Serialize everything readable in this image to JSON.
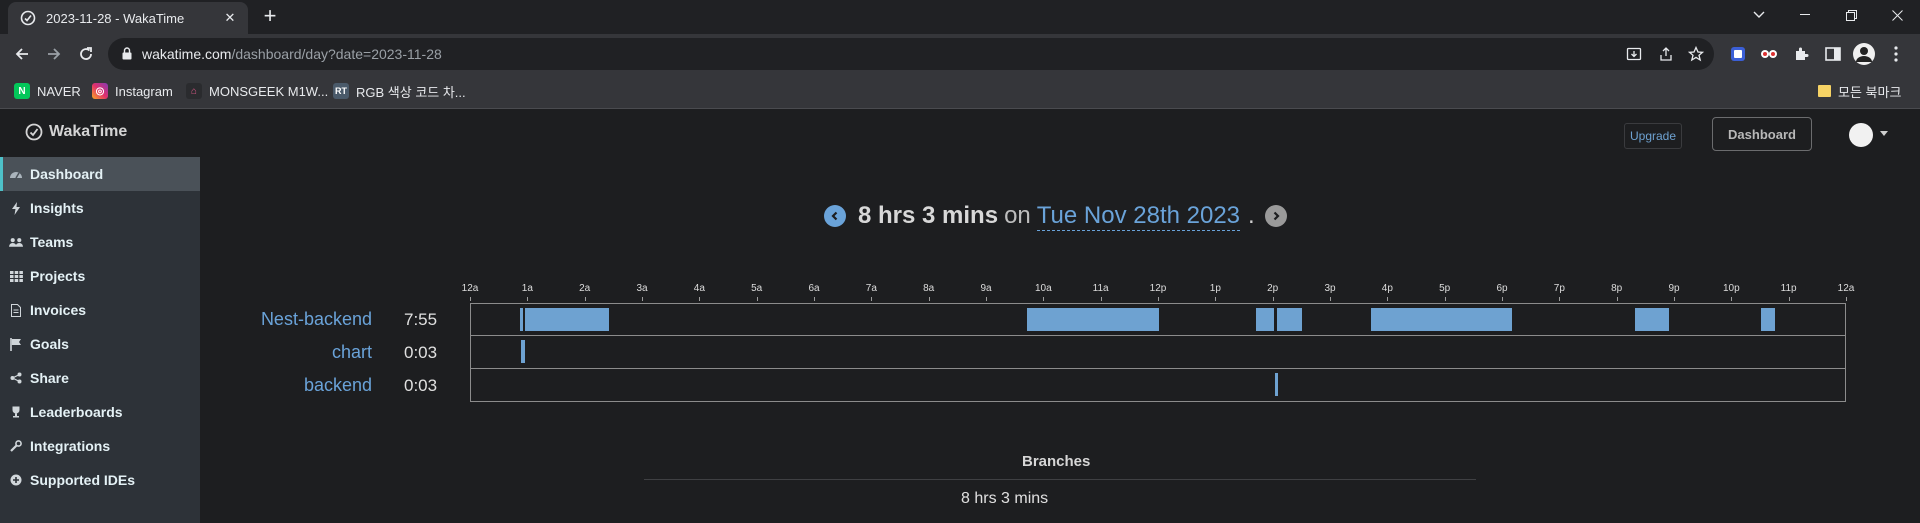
{
  "browser": {
    "tab_title": "2023-11-28 - WakaTime",
    "url_host": "wakatime.com",
    "url_path": "/dashboard/day?date=2023-11-28",
    "bookmarks": [
      {
        "label": "NAVER",
        "icon": "naver-icon"
      },
      {
        "label": "Instagram",
        "icon": "instagram-icon"
      },
      {
        "label": "MONSGEEK M1W...",
        "icon": "monsgeek-icon"
      },
      {
        "label": "RGB 색상 코드 차...",
        "icon": "rgb-icon"
      }
    ],
    "bookmarks_folder": "모든 북마크"
  },
  "app": {
    "logo": "WakaTime",
    "upgrade_label": "Upgrade",
    "dashboard_label": "Dashboard"
  },
  "sidebar": {
    "items": [
      {
        "label": "Dashboard",
        "icon": "dashboard-icon",
        "active": true
      },
      {
        "label": "Insights",
        "icon": "bolt-icon"
      },
      {
        "label": "Teams",
        "icon": "users-icon"
      },
      {
        "label": "Projects",
        "icon": "grid-icon"
      },
      {
        "label": "Invoices",
        "icon": "document-icon"
      },
      {
        "label": "Goals",
        "icon": "flag-icon"
      },
      {
        "label": "Share",
        "icon": "share-icon"
      },
      {
        "label": "Leaderboards",
        "icon": "trophy-icon"
      },
      {
        "label": "Integrations",
        "icon": "wrench-icon"
      },
      {
        "label": "Supported IDEs",
        "icon": "plus-circle-icon"
      }
    ]
  },
  "summary": {
    "duration": "8 hrs 3 mins",
    "on": "on",
    "date": "Tue Nov 28th 2023",
    "dot": "."
  },
  "chart_data": {
    "type": "timeline",
    "x_ticks": [
      "12a",
      "1a",
      "2a",
      "3a",
      "4a",
      "5a",
      "6a",
      "7a",
      "8a",
      "9a",
      "10a",
      "11a",
      "12p",
      "1p",
      "2p",
      "3p",
      "4p",
      "5p",
      "6p",
      "7p",
      "8p",
      "9p",
      "10p",
      "11p",
      "12a"
    ],
    "xlim_hours": [
      0,
      24
    ],
    "projects": [
      {
        "name": "Nest-backend",
        "total": "7:55",
        "sessions_hours": [
          [
            0.85,
            0.9
          ],
          [
            0.95,
            2.4
          ],
          [
            9.7,
            12.0
          ],
          [
            13.7,
            14.0
          ],
          [
            14.05,
            14.5
          ],
          [
            15.7,
            18.15
          ],
          [
            20.3,
            20.9
          ],
          [
            22.5,
            22.75
          ]
        ]
      },
      {
        "name": "chart",
        "total": "0:03",
        "sessions_hours": [
          [
            0.88,
            0.95
          ]
        ]
      },
      {
        "name": "backend",
        "total": "0:03",
        "sessions_hours": [
          [
            14.02,
            14.07
          ]
        ]
      }
    ],
    "colors": {
      "bar": "#6ea2d1"
    }
  },
  "branches": {
    "title": "Branches",
    "total": "8 hrs 3 mins"
  }
}
